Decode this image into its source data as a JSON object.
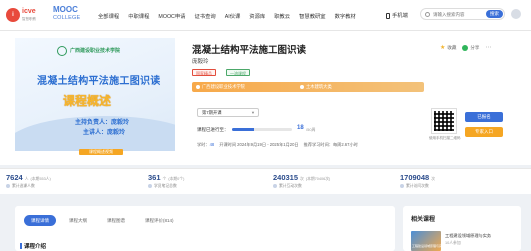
{
  "header": {
    "logo1": "icve",
    "logo1_sub": "智慧职教",
    "logo2": "MOOC",
    "logo2_sub": "COLLEGE",
    "nav": [
      "全部课程",
      "中职课程",
      "MOOC申请",
      "证书查询",
      "AI伙课",
      "资源库",
      "职教云",
      "智慧教研室",
      "数字教材"
    ],
    "phone": "手机端",
    "search_placeholder": "请输入搜索内容",
    "search_button": "搜索"
  },
  "cover": {
    "school": "广西建设职业技术学院",
    "title": "混凝土结构平法施工图识读",
    "subtitle": "课程概述",
    "teacher": "主持负责人：庞毅玲",
    "lecturer": "主讲人：庞毅玲",
    "intro_tag": "课程概述视频"
  },
  "course": {
    "title": "混凝土结构平法施工图识读",
    "author": "庞毅玲",
    "tag1": "国家精品",
    "tag2": "一流课程",
    "actions": {
      "favorite": "收藏",
      "share": "分享"
    },
    "org1": "广西建设职业技术学院",
    "org2": "土木建筑大类",
    "term": "第7期开课",
    "progress_label": "课程已进行至：",
    "progress_fraction": 0.36,
    "progress_count": "18",
    "progress_total": "/50周",
    "meta_term_label": "学时：",
    "meta_term": "48",
    "meta_open": "开课时间 2024年9月19日 - 2025年1月20日",
    "meta_study": "推荐学习时间：每周2.67小时",
    "qr_caption": "使用手机扫描二维码",
    "btn_join": "已报名",
    "btn_teacher": "专家入口",
    "colors": {
      "accent": "#3a6fd8",
      "orange": "#f5a623"
    }
  },
  "stats": [
    {
      "big": "7624",
      "unit": "人",
      "small": "(本期553人)",
      "label": "累计选课人数"
    },
    {
      "big": "361",
      "unit": "个",
      "small": "(本期0个)",
      "label": "学员笔记总数"
    },
    {
      "big": "240315",
      "unit": "次",
      "small": "(本期70406次)",
      "label": "累计互动次数"
    },
    {
      "big": "1709048",
      "unit": "次",
      "small": "",
      "label": "累计访问次数"
    }
  ],
  "tabs": [
    "课程详情",
    "课程大纲",
    "课程图谱",
    "课程评价(814)"
  ],
  "intro_heading": "课程介绍",
  "related": {
    "title": "相关课程",
    "name": "工程建设领域原理与实务",
    "sub": "10人参加",
    "thumb_text": "工程建设领域原理与实务"
  }
}
